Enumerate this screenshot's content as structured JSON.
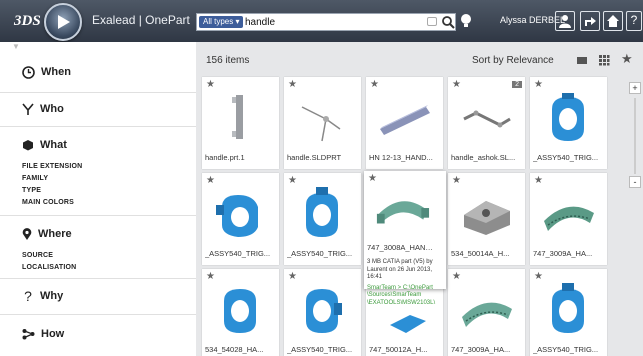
{
  "header": {
    "brand": "3DS",
    "title": "Exalead | OnePart",
    "search": {
      "type_label": "All types ▾",
      "query": "handle"
    },
    "user": "Alyssa DERBEL"
  },
  "sidebar": {
    "facets": [
      {
        "label": "When",
        "icon": "clock-icon"
      },
      {
        "label": "Who",
        "icon": "person-icon"
      },
      {
        "label": "What",
        "icon": "cube-icon",
        "items": [
          "FILE EXTENSION",
          "FAMILY",
          "TYPE",
          "MAIN COLORS"
        ]
      },
      {
        "label": "Where",
        "icon": "location-pin-icon",
        "items": [
          "SOURCE",
          "LOCALISATION"
        ]
      },
      {
        "label": "Why",
        "icon": "question-icon"
      },
      {
        "label": "How",
        "icon": "workflow-icon"
      }
    ]
  },
  "main": {
    "count_label": "156 items",
    "sort_label": "Sort by Relevance",
    "zoom_in": "+",
    "zoom_out": "-",
    "tiles": [
      {
        "caption": "handle.prt.1"
      },
      {
        "caption": "handle.SLDPRT"
      },
      {
        "caption": "HN 12-13_HAND..."
      },
      {
        "caption": "handle_ashok.SL...",
        "badge": "2"
      },
      {
        "caption": "_ASSY540_TRIG..."
      },
      {
        "caption": "_ASSY540_TRIG..."
      },
      {
        "caption": "_ASSY540_TRIG..."
      },
      {
        "caption": "747_3008A_HANDL...",
        "tooltip": {
          "line1": "3 MB CATIA part (V5) by",
          "line2": "Laurent on 26 Jun 2013,",
          "line3": "16:41",
          "path1": "SmarTeam > C:\\OnePart",
          "path2": "\\Sources\\SmarTeam",
          "path3": "\\EXATOOLS\\MSW2103L\\"
        }
      },
      {
        "caption": "534_50014A_H..."
      },
      {
        "caption": "747_3009A_HA..."
      },
      {
        "caption": "534_54028_HA..."
      },
      {
        "caption": "_ASSY540_TRIG..."
      },
      {
        "caption": "747_50012A_H..."
      },
      {
        "caption": "747_3009A_HA..."
      },
      {
        "caption": "_ASSY540_TRIG..."
      }
    ]
  },
  "colors": {
    "topbar": "#3a4350",
    "accent": "#3d5d9a",
    "part_blue": "#2b8fd6",
    "part_green": "#5a9a86"
  }
}
